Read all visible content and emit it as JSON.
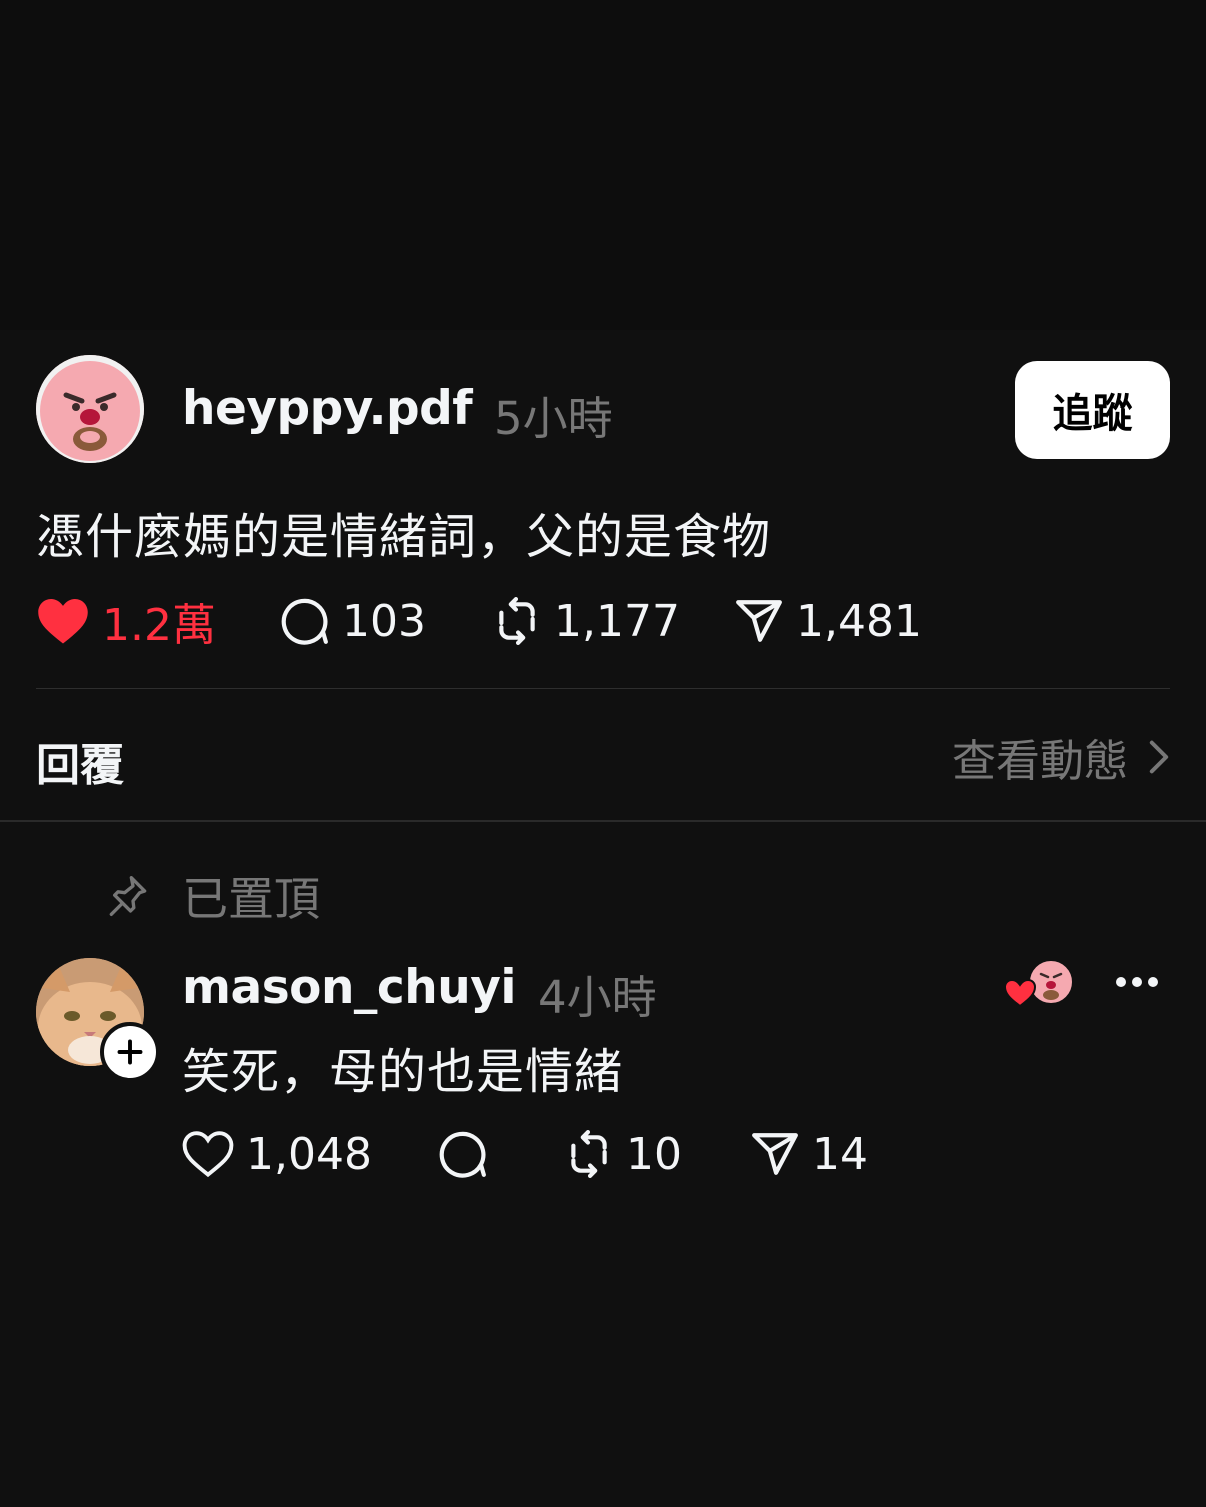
{
  "post": {
    "username": "heyppy.pdf",
    "time": "5小時",
    "follow_label": "追蹤",
    "text": "憑什麼媽的是情緒詞，父的是食物",
    "likes": "1.2萬",
    "comments": "103",
    "reposts": "1,177",
    "shares": "1,481",
    "liked": true
  },
  "replies_section": {
    "title": "回覆",
    "view_activity_label": "查看動態"
  },
  "reply": {
    "pinned_label": "已置頂",
    "username": "mason_chuyi",
    "time": "4小時",
    "text": "笑死，母的也是情緒",
    "likes": "1,048",
    "reposts": "10",
    "shares": "14"
  },
  "colors": {
    "background": "#101010",
    "primary_text": "#f3f5f7",
    "secondary_text": "#777777",
    "like_red": "#ff3040"
  },
  "icons": {
    "like": "heart-icon",
    "comment": "speech-bubble-icon",
    "repost": "repost-icon",
    "share": "paper-plane-icon",
    "pin": "pin-icon",
    "chevron": "chevron-right-icon",
    "more": "ellipsis-icon",
    "follow_badge": "plus-icon"
  }
}
